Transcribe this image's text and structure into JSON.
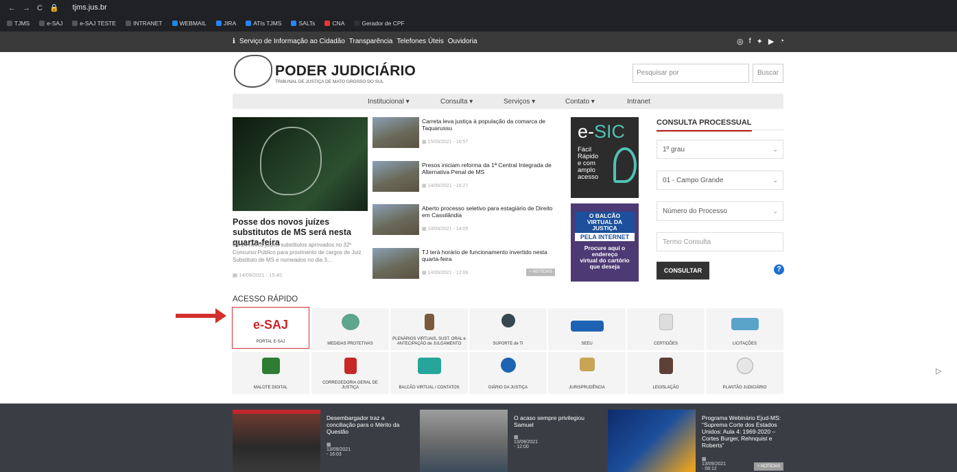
{
  "browser": {
    "url": "tjms.jus.br",
    "bookmarks": [
      {
        "label": "TJMS",
        "color": "#555"
      },
      {
        "label": "e-SAJ",
        "color": "#555"
      },
      {
        "label": "e-SAJ TESTE",
        "color": "#555"
      },
      {
        "label": "INTRANET",
        "color": "#555"
      },
      {
        "label": "WEBMAIL",
        "color": "#1e88e5"
      },
      {
        "label": "JIRA",
        "color": "#2684ff"
      },
      {
        "label": "ATIs TJMS",
        "color": "#2684ff"
      },
      {
        "label": "SALTs",
        "color": "#2684ff"
      },
      {
        "label": "CNA",
        "color": "#e53935"
      },
      {
        "label": "Gerador de CPF",
        "color": "#333"
      }
    ]
  },
  "topbar": {
    "links": [
      "Serviço de Informação ao Cidadão",
      "Transparência",
      "Telefones Úteis",
      "Ouvidoria"
    ],
    "social_icons": [
      "instagram-icon",
      "facebook-icon",
      "twitter-icon",
      "youtube-icon",
      "rss-icon"
    ]
  },
  "header": {
    "title": "PODER JUDICIÁRIO",
    "subtitle": "TRIBUNAL DE JUSTIÇA DE MATO GROSSO DO SUL",
    "search_placeholder": "Pesquisar por",
    "search_button": "Buscar"
  },
  "menu": [
    {
      "label": "Institucional ▾"
    },
    {
      "label": "Consulta ▾"
    },
    {
      "label": "Serviços ▾"
    },
    {
      "label": "Contato ▾"
    },
    {
      "label": "Intranet"
    }
  ],
  "feature": {
    "title": "Posse dos novos juízes substitutos de MS será nesta quarta-feira",
    "desc": "Os 14 novos juízes substitutos aprovados no 32º Concurso Público para provimento de cargos de Juiz Substituto de MS e nomeados no dia 3...",
    "date": "14/09/2021 - 15:45"
  },
  "news": [
    {
      "title": "Carreta leva justiça à população da comarca de Taquarussu",
      "date": "15/09/2021 - 10:57"
    },
    {
      "title": "Presos iniciam reforma da 1ª Central Integrada de Alternativa Penal de MS",
      "date": "14/09/2021 - 16:27"
    },
    {
      "title": "Aberto processo seletivo para estagiário de Direito em Cassilândia",
      "date": "14/09/2021 - 14:05"
    },
    {
      "title": "TJ terá horário de funcionamento invertido nesta quarta-feira",
      "date": "14/09/2021 - 12:06"
    }
  ],
  "more_news": "+ NOTÍCIAS",
  "esic": {
    "big_prefix": "e-",
    "big_suffix": "SIC",
    "text": "Fácil\nRápido\ne com\namplo\nacesso"
  },
  "balcao": {
    "line1": "O BALCÃO VIRTUAL DA JUSTIÇA",
    "line2": "PELA INTERNET",
    "line3": "Procure aqui o\nendereço\nvirtual do cartório\nque deseja"
  },
  "consulta": {
    "title": "CONSULTA PROCESSUAL",
    "grau": "1º grau",
    "comarca": "01 - Campo Grande",
    "tipo": "Número do Processo",
    "termo_placeholder": "Termo Consulta",
    "button": "CONSULTAR"
  },
  "acesso": {
    "title": "ACESSO RÁPIDO",
    "esaj_logo": "e-SAJ",
    "tiles": [
      "PORTAL E-SAJ",
      "MEDIDAS PROTETIVAS",
      "PLENÁRIOS VIRTUAIS, SUST. ORAL e ANTECIPAÇÃO de JULGAMENTO",
      "SUPORTE de TI",
      "SEEU",
      "CERTIDÕES",
      "LICITAÇÕES",
      "MALOTE DIGITAL",
      "CORREGEDORIA GERAL DE JUSTIÇA",
      "BALCÃO VIRTUAL / CONTATOS",
      "DIÁRIO DA JUSTIÇA",
      "JURISPRUDÊNCIA",
      "LEGISLAÇÃO",
      "PLANTÃO JUDICIÁRIO"
    ]
  },
  "footer_news": [
    {
      "title": "Desembargador traz a conciliação para o Mérito da Questão",
      "date": "13/09/2021 - 16:03"
    },
    {
      "title": "O acaso sempre privilegiou Samuel",
      "date": "13/09/2021 - 12:00"
    },
    {
      "title": "Programa Webinário Ejud-MS: “Suprema Corte dos Estados Unidos: Aula 4: 1969-2020 – Cortes Burger, Rehnquist e Roberts”",
      "date": "13/09/2021 - 08:12"
    }
  ]
}
